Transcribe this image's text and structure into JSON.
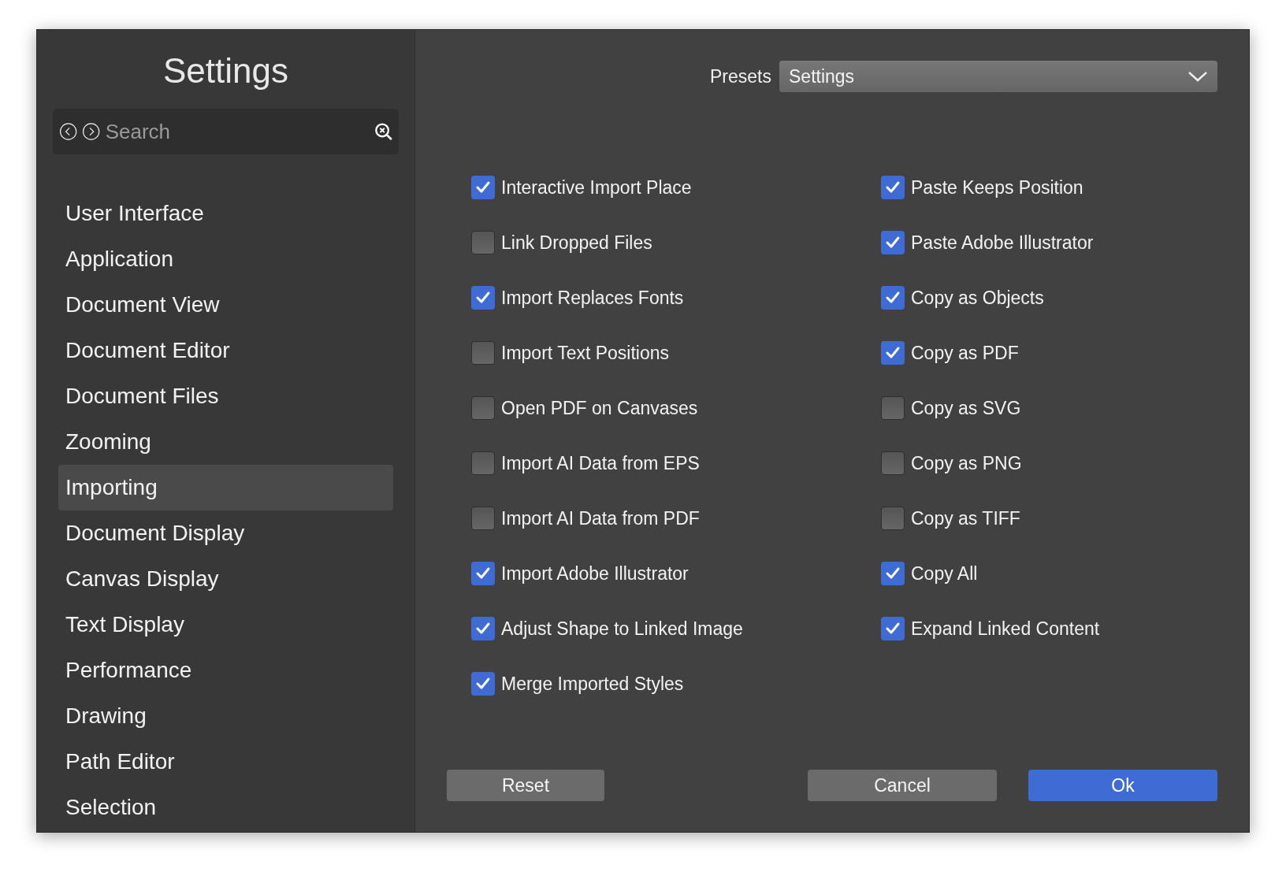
{
  "sidebar": {
    "title": "Settings",
    "search": {
      "placeholder": "Search"
    },
    "items": [
      {
        "label": "User Interface",
        "selected": false
      },
      {
        "label": "Application",
        "selected": false
      },
      {
        "label": "Document View",
        "selected": false
      },
      {
        "label": "Document Editor",
        "selected": false
      },
      {
        "label": "Document Files",
        "selected": false
      },
      {
        "label": "Zooming",
        "selected": false
      },
      {
        "label": "Importing",
        "selected": true
      },
      {
        "label": "Document Display",
        "selected": false
      },
      {
        "label": "Canvas Display",
        "selected": false
      },
      {
        "label": "Text Display",
        "selected": false
      },
      {
        "label": "Performance",
        "selected": false
      },
      {
        "label": "Drawing",
        "selected": false
      },
      {
        "label": "Path Editor",
        "selected": false
      },
      {
        "label": "Selection",
        "selected": false
      }
    ]
  },
  "presets": {
    "label": "Presets",
    "value": "Settings"
  },
  "options_left": [
    {
      "label": "Interactive Import Place",
      "checked": true
    },
    {
      "label": "Link Dropped Files",
      "checked": false
    },
    {
      "label": "Import Replaces Fonts",
      "checked": true
    },
    {
      "label": "Import Text Positions",
      "checked": false
    },
    {
      "label": "Open PDF on Canvases",
      "checked": false
    },
    {
      "label": "Import AI Data from EPS",
      "checked": false
    },
    {
      "label": "Import AI Data from PDF",
      "checked": false
    },
    {
      "label": "Import Adobe Illustrator",
      "checked": true
    },
    {
      "label": "Adjust Shape to Linked Image",
      "checked": true
    },
    {
      "label": "Merge Imported Styles",
      "checked": true
    }
  ],
  "options_right": [
    {
      "label": "Paste Keeps Position",
      "checked": true
    },
    {
      "label": "Paste Adobe Illustrator",
      "checked": true
    },
    {
      "label": "Copy as Objects",
      "checked": true
    },
    {
      "label": "Copy as PDF",
      "checked": true
    },
    {
      "label": "Copy as SVG",
      "checked": false
    },
    {
      "label": "Copy as PNG",
      "checked": false
    },
    {
      "label": "Copy as TIFF",
      "checked": false
    },
    {
      "label": "Copy All",
      "checked": true
    },
    {
      "label": "Expand Linked Content",
      "checked": true
    }
  ],
  "buttons": {
    "reset": "Reset",
    "cancel": "Cancel",
    "ok": "Ok"
  }
}
